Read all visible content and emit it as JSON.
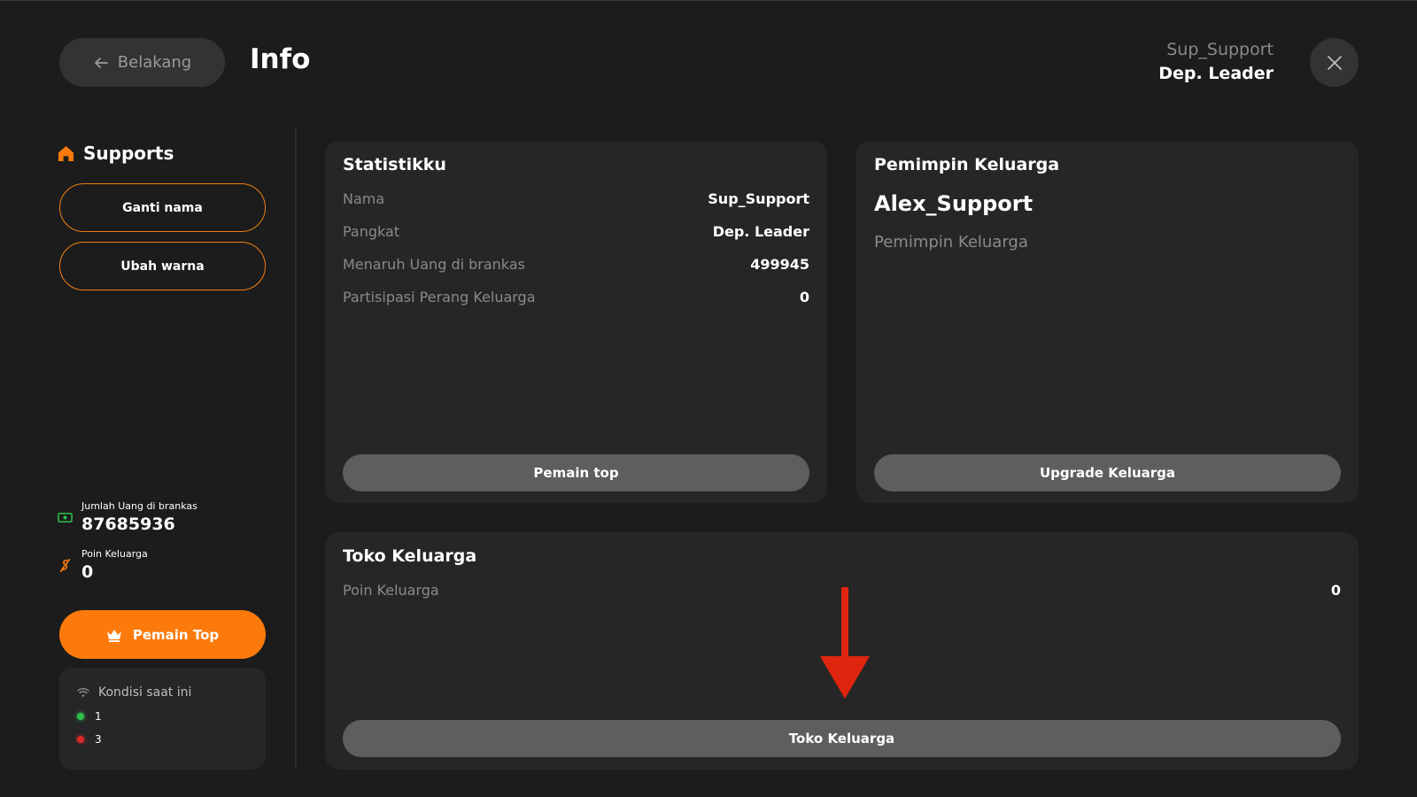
{
  "header": {
    "back_label": "Belakang",
    "title": "Info",
    "user_name": "Sup_Support",
    "user_rank": "Dep. Leader"
  },
  "sidebar": {
    "title": "Supports",
    "rename_label": "Ganti nama",
    "color_label": "Ubah warna",
    "vault_label": "Jumlah Uang di brankas",
    "vault_value": "87685936",
    "points_label": "Poin Keluarga",
    "points_value": "0",
    "top_players_label": "Pemain Top",
    "condition": {
      "title": "Kondisi saat ini",
      "rows": [
        {
          "value": "1",
          "color": "#2fbf4a"
        },
        {
          "value": "3",
          "color": "#d62b2b"
        }
      ]
    }
  },
  "stats_card": {
    "title": "Statistikku",
    "rows": [
      {
        "key": "Nama",
        "value": "Sup_Support"
      },
      {
        "key": "Pangkat",
        "value": "Dep. Leader"
      },
      {
        "key": "Menaruh Uang di brankas",
        "value": "499945"
      },
      {
        "key": "Partisipasi Perang Keluarga",
        "value": "0"
      }
    ],
    "button_label": "Pemain top"
  },
  "leader_card": {
    "title": "Pemimpin Keluarga",
    "name": "Alex_Support",
    "role": "Pemimpin Keluarga",
    "button_label": "Upgrade Keluarga"
  },
  "shop_card": {
    "title": "Toko Keluarga",
    "points_label": "Poin Keluarga",
    "points_value": "0",
    "button_label": "Toko Keluarga"
  },
  "colors": {
    "accent": "#fb7a0b",
    "background": "#1c1c1c",
    "card": "#262626",
    "annotation_arrow": "#e0250f"
  },
  "icons": {
    "back": "arrow-left-icon",
    "close": "close-icon",
    "sidebar": "home-icon",
    "vault": "cash-icon",
    "points": "points-icon",
    "top_players": "crown-icon",
    "condition": "wifi-icon"
  }
}
